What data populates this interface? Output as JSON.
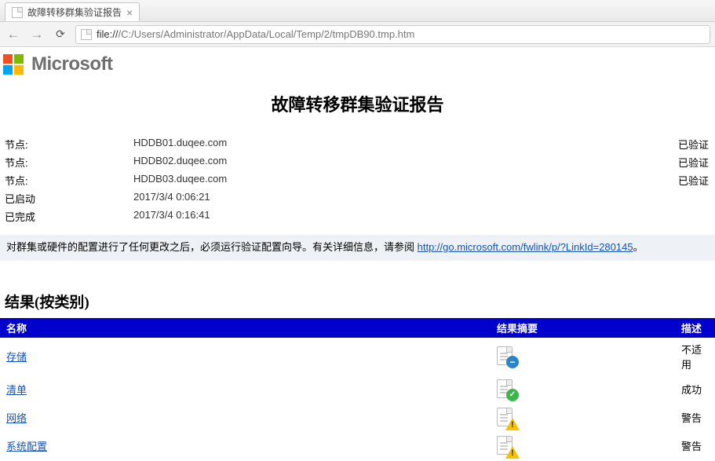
{
  "tab": {
    "title": "故障转移群集验证报告"
  },
  "addressbar": {
    "scheme": "file://",
    "path": "/C:/Users/Administrator/AppData/Local/Temp/2/tmpDB90.tmp.htm"
  },
  "brand": {
    "name": "Microsoft"
  },
  "report": {
    "title": "故障转移群集验证报告",
    "meta_rows": [
      {
        "label": "节点:",
        "value": "HDDB01.duqee.com",
        "status": "已验证"
      },
      {
        "label": "节点:",
        "value": "HDDB02.duqee.com",
        "status": "已验证"
      },
      {
        "label": "节点:",
        "value": "HDDB03.duqee.com",
        "status": "已验证"
      },
      {
        "label": "已启动",
        "value": "2017/3/4 0:06:21",
        "status": ""
      },
      {
        "label": "已完成",
        "value": "2017/3/4 0:16:41",
        "status": ""
      }
    ],
    "notice_pre": "对群集或硬件的配置进行了任何更改之后，必须运行验证配置向导。有关详细信息，请参阅 ",
    "notice_link_text": "http://go.microsoft.com/fwlink/p/?LinkId=280145",
    "notice_post": "。",
    "section_title": "结果(按类别)",
    "columns": {
      "name": "名称",
      "summary": "结果摘要",
      "desc": "描述"
    },
    "rows": [
      {
        "name": "存储",
        "status": "na",
        "desc": "不适用"
      },
      {
        "name": "清单",
        "status": "ok",
        "desc": "成功"
      },
      {
        "name": "网络",
        "status": "warn",
        "desc": "警告"
      },
      {
        "name": "系统配置",
        "status": "warn",
        "desc": "警告"
      }
    ]
  }
}
